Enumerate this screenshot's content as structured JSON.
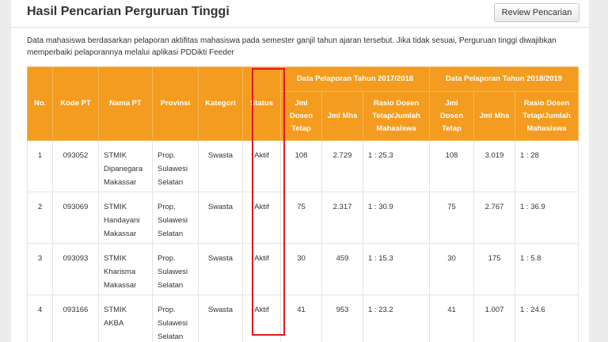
{
  "header": {
    "title": "Hasil Pencarian Perguruan Tinggi",
    "review_button": "Review Pencarian"
  },
  "description": "Data mahasiswa berdasarkan pelaporan aktifitas mahasiswa pada semester ganjil tahun ajaran tersebut. Jika tidak sesuai, Perguruan tinggi diwajibkan memperbaiki pelaporannya melalui aplikasi PDDikti Feeder",
  "table": {
    "columns": {
      "no": "No.",
      "kode_pt": "Kode PT",
      "nama_pt": "Nama PT",
      "provinsi": "Provinsi",
      "kategori": "Kategori",
      "status": "Status",
      "period_2017": "Data Pelaporan Tahun 2017/2018",
      "period_2018": "Data Pelaporan Tahun 2018/2019",
      "jml_dosen": "Jml Dosen Tetap",
      "jml_mhs": "Jml Mhs",
      "rasio": "Rasio Dosen Tetap/Jumlah Mahasiswa"
    },
    "rows": [
      {
        "no": "1",
        "kode": "093052",
        "nama": "STMIK Dipanegara Makassar",
        "provinsi": "Prop. Sulawesi Selatan",
        "kategori": "Swasta",
        "status": "Aktif",
        "dosen_2017": "108",
        "mhs_2017": "2.729",
        "rasio_2017": "1 : 25.3",
        "dosen_2018": "108",
        "mhs_2018": "3.019",
        "rasio_2018": "1 : 28"
      },
      {
        "no": "2",
        "kode": "093069",
        "nama": "STMIK Handayani Makassar",
        "provinsi": "Prop. Sulawesi Selatan",
        "kategori": "Swasta",
        "status": "Aktif",
        "dosen_2017": "75",
        "mhs_2017": "2.317",
        "rasio_2017": "1 : 30.9",
        "dosen_2018": "75",
        "mhs_2018": "2.767",
        "rasio_2018": "1 : 36.9"
      },
      {
        "no": "3",
        "kode": "093093",
        "nama": "STMIK Kharisma Makassar",
        "provinsi": "Prop. Sulawesi Selatan",
        "kategori": "Swasta",
        "status": "Aktif",
        "dosen_2017": "30",
        "mhs_2017": "459",
        "rasio_2017": "1 : 15.3",
        "dosen_2018": "30",
        "mhs_2018": "175",
        "rasio_2018": "1 : 5.8"
      },
      {
        "no": "4",
        "kode": "093166",
        "nama": "STMIK AKBA",
        "provinsi": "Prop. Sulawesi Selatan",
        "kategori": "Swasta",
        "status": "Aktif",
        "dosen_2017": "41",
        "mhs_2017": "953",
        "rasio_2017": "1 : 23.2",
        "dosen_2018": "41",
        "mhs_2018": "1.007",
        "rasio_2018": "1 : 24.6"
      }
    ]
  },
  "colors": {
    "header_orange": "#f39c1f",
    "link_orange": "#e8891a",
    "highlight_red": "#e0191f"
  }
}
